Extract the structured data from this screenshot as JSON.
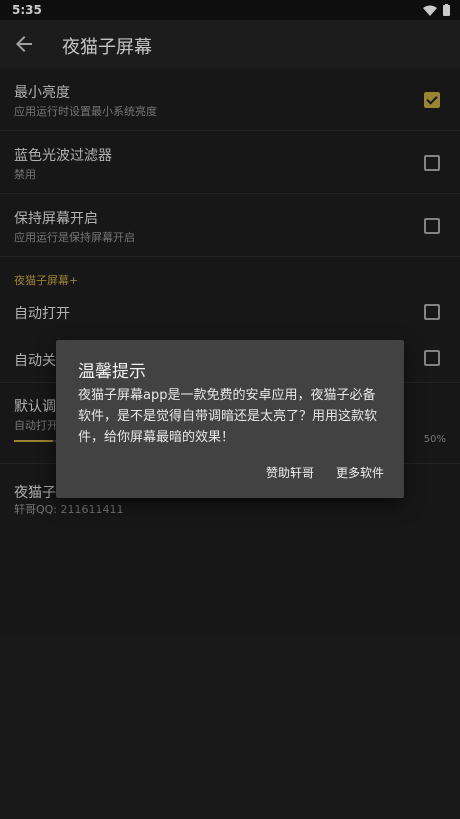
{
  "status": {
    "time": "5:35"
  },
  "appbar": {
    "title": "夜猫子屏幕"
  },
  "settings": [
    {
      "title": "最小亮度",
      "subtitle": "应用运行时设置最小系统亮度",
      "checked": true
    },
    {
      "title": "蓝色光波过滤器",
      "subtitle": "禁用",
      "checked": false
    },
    {
      "title": "保持屏幕开启",
      "subtitle": "应用运行是保持屏幕开启",
      "checked": false
    }
  ],
  "section": {
    "label": "夜猫子屏幕+"
  },
  "auto_open": {
    "title": "自动打开",
    "checked": false
  },
  "auto_close": {
    "title": "自动关",
    "checked": false
  },
  "default_dim": {
    "title": "默认调",
    "subtitle": "自动打开",
    "percent": "50%",
    "fill_fraction": 0.1
  },
  "about": {
    "title": "夜猫子",
    "qq": "轩哥QQ: 211611411"
  },
  "dialog": {
    "title": "温馨提示",
    "body": "夜猫子屏幕app是一款免费的安卓应用，夜猫子必备软件，是不是觉得自带调暗还是太亮了？用用这款软件，给你屏幕最暗的效果！",
    "btn_sponsor": "赞助轩哥",
    "btn_more": "更多软件"
  },
  "colors": {
    "accent": "#b59a3c",
    "background": "#1c1c1c",
    "dialog": "#424242"
  }
}
